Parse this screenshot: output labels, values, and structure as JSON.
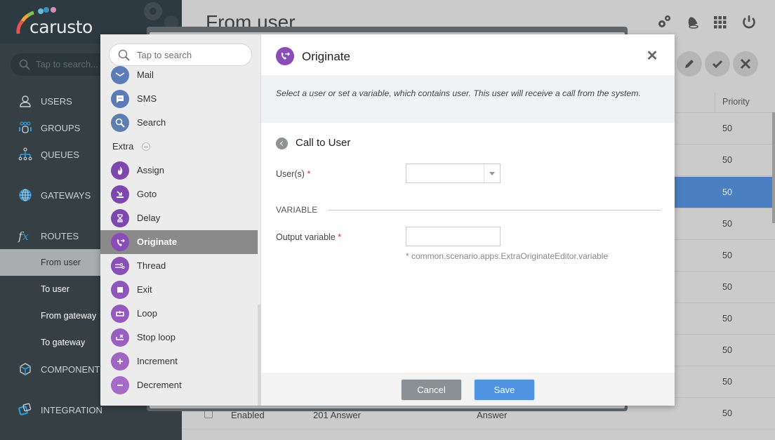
{
  "app": {
    "logo_text": "carusto",
    "sidebar_search_placeholder": "Tap to search...",
    "page_title": "From user"
  },
  "sidebar": {
    "items": [
      {
        "label": "USERS",
        "icon": "user-icon"
      },
      {
        "label": "GROUPS",
        "icon": "group-icon"
      },
      {
        "label": "QUEUES",
        "icon": "queue-icon"
      },
      {
        "label": "GATEWAYS",
        "icon": "globe-icon"
      },
      {
        "label": "ROUTES",
        "icon": "function-icon"
      },
      {
        "label": "COMPONENTS",
        "icon": "cube-icon"
      },
      {
        "label": "INTEGRATION",
        "icon": "integration-icon"
      }
    ],
    "routes_sub": [
      {
        "label": "From user",
        "active": true
      },
      {
        "label": "To user",
        "active": false
      },
      {
        "label": "From gateway",
        "active": false
      },
      {
        "label": "To gateway",
        "active": false
      }
    ]
  },
  "topbar": {
    "icons": [
      "settings-icon",
      "bell-icon",
      "apps-grid-icon",
      "power-icon"
    ]
  },
  "toolbar": {
    "icons": [
      "edit-icon",
      "check-icon",
      "close-icon"
    ]
  },
  "table": {
    "header_priority": "Priority",
    "priorities": [
      "50",
      "50",
      "50",
      "50",
      "50",
      "50",
      "50",
      "50",
      "50",
      "50"
    ],
    "selected_row_index": 2,
    "bottom_row": {
      "status": "Enabled",
      "name": "201 Answer",
      "action": "Answer",
      "priority": "50"
    }
  },
  "palette": {
    "search_placeholder": "Tap to search",
    "items_top": [
      {
        "label": "Mail",
        "icon": "mail-icon"
      },
      {
        "label": "SMS",
        "icon": "sms-icon"
      },
      {
        "label": "Search",
        "icon": "search-icon"
      }
    ],
    "section": "Extra",
    "items_extra": [
      {
        "label": "Assign",
        "icon": "flame-icon"
      },
      {
        "label": "Goto",
        "icon": "goto-icon"
      },
      {
        "label": "Delay",
        "icon": "hourglass-icon"
      },
      {
        "label": "Originate",
        "icon": "phone-forward-icon",
        "active": true
      },
      {
        "label": "Thread",
        "icon": "thread-icon"
      },
      {
        "label": "Exit",
        "icon": "stop-icon"
      },
      {
        "label": "Loop",
        "icon": "loop-icon"
      },
      {
        "label": "Stop loop",
        "icon": "stop-loop-icon"
      },
      {
        "label": "Increment",
        "icon": "plus-icon"
      },
      {
        "label": "Decrement",
        "icon": "minus-icon"
      }
    ]
  },
  "editor": {
    "title": "Originate",
    "description": "Select a user or set a variable, which contains user. This user will receive a call from the system.",
    "back_label": "Call to User",
    "users_label": "User(s)",
    "users_value": "",
    "required_mark": "*",
    "section_variable": "VARIABLE",
    "output_variable_label": "Output variable",
    "output_variable_value": "",
    "hint": "* common.scenario.apps.ExtraOriginateEditor.variable",
    "cancel_label": "Cancel",
    "save_label": "Save"
  },
  "colors": {
    "accent_blue": "#4e94e3",
    "selected_row": "#4a7fc1",
    "purple": "#8a4cb6",
    "blue_icon": "#5b7cb8",
    "sidebar_bg": "#353f44"
  }
}
